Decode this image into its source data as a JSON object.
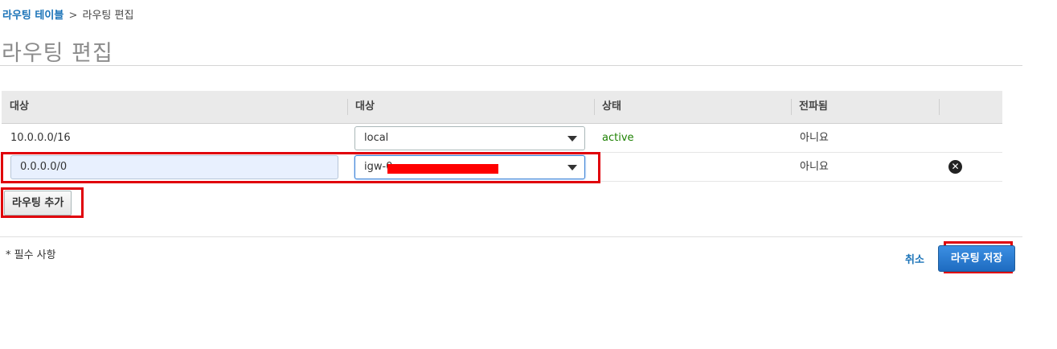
{
  "breadcrumb": {
    "parent": "라우팅 테이블",
    "separator": ">",
    "current": "라우팅 편집"
  },
  "page_title": "라우팅 편집",
  "table": {
    "headers": [
      "대상",
      "대상",
      "상태",
      "전파됨"
    ],
    "rows": [
      {
        "destination": "10.0.0.0/16",
        "target": "local",
        "status": "active",
        "propagated": "아니요"
      },
      {
        "destination": "0.0.0.0/0",
        "target": "igw-0",
        "status": "",
        "propagated": "아니요"
      }
    ]
  },
  "add_route_label": "라우팅 추가",
  "required_note": "* 필수 사항",
  "cancel_label": "취소",
  "save_label": "라우팅 저장",
  "icons": {
    "remove": "close-circle-icon",
    "dropdown": "caret-down-icon"
  },
  "colors": {
    "link": "#1a73b8",
    "status_active": "#1d8102",
    "primary_button": "#1e6bc0",
    "annotation": "#e0000a",
    "redaction": "#ff0000"
  }
}
